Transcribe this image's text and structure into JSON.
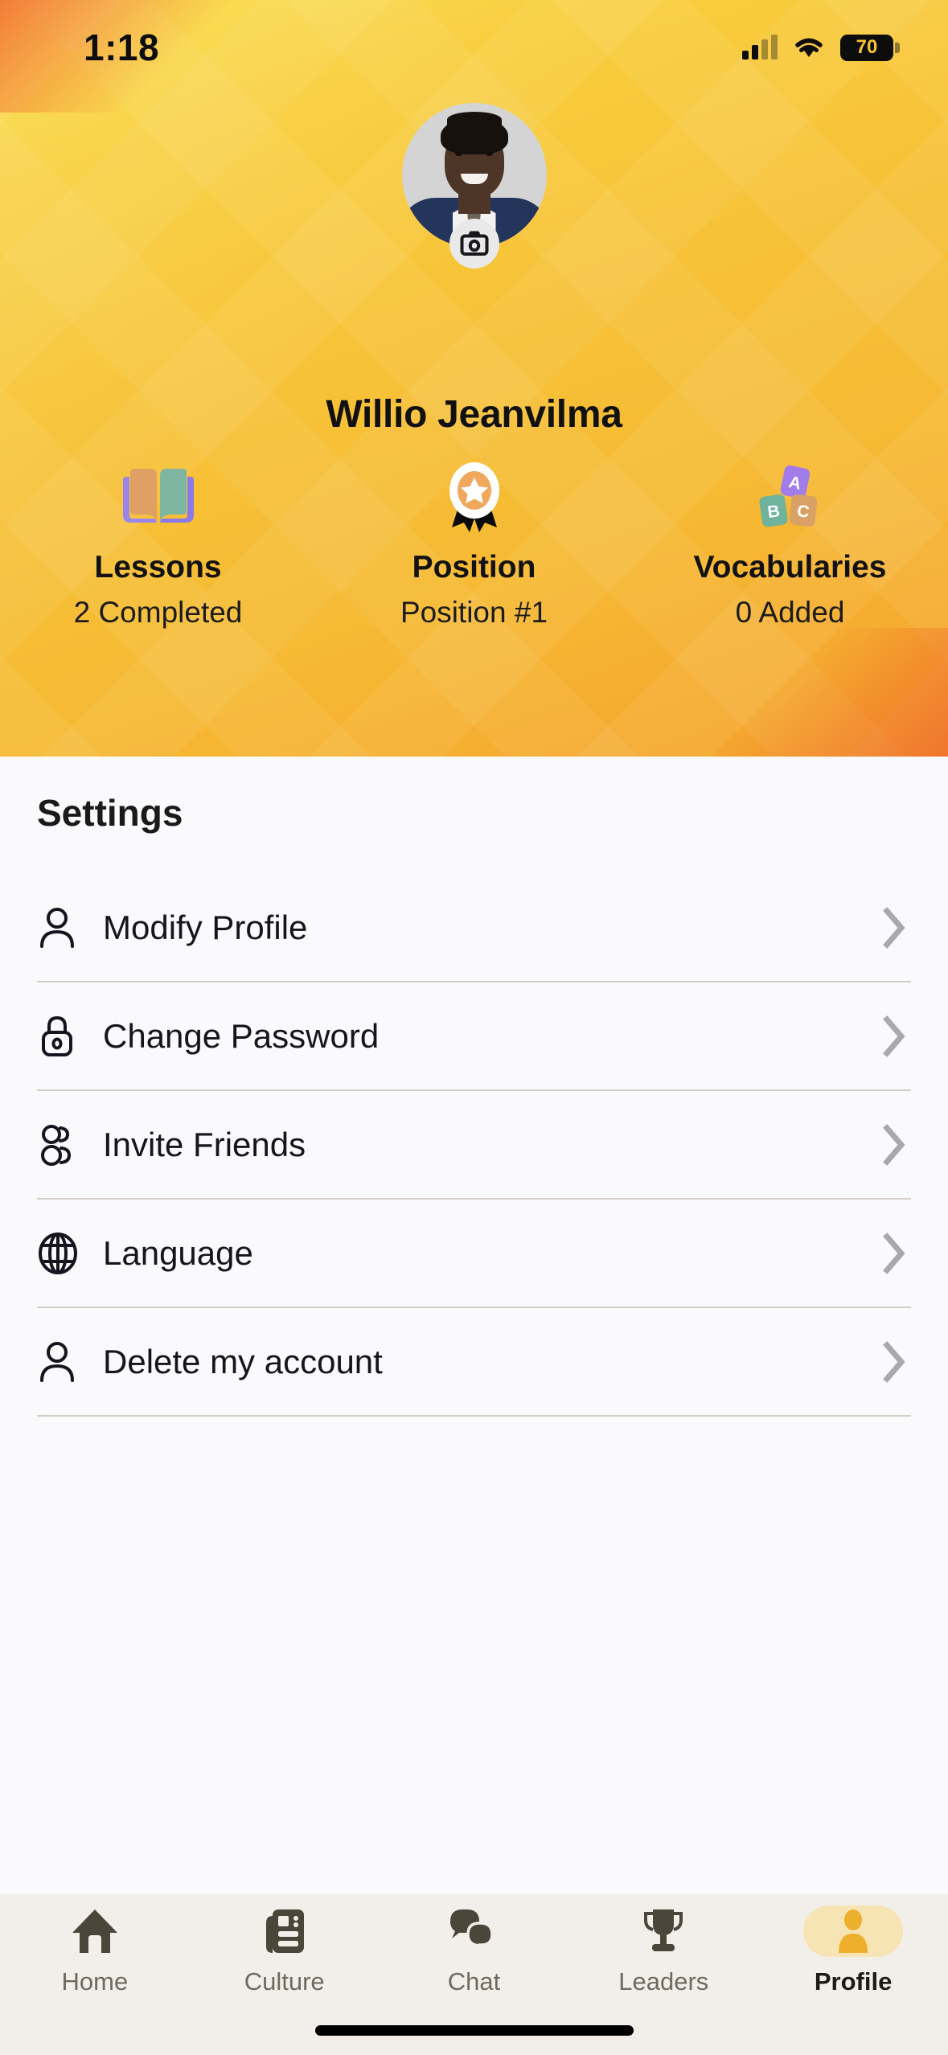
{
  "statusbar": {
    "time": "1:18",
    "battery_level": "70",
    "signal_icon": "cellular-signal-icon",
    "wifi_icon": "wifi-icon",
    "battery_icon": "battery-icon"
  },
  "header": {
    "background_color": "#f7c238",
    "accent_color": "#f05a28",
    "avatar_icon": "user-avatar-photo",
    "camera_badge_icon": "camera-icon",
    "profile_name": "Willio Jeanvilma"
  },
  "stats": [
    {
      "icon": "open-book-icon",
      "label": "Lessons",
      "value": "2 Completed"
    },
    {
      "icon": "medal-award-icon",
      "label": "Position",
      "value": "Position #1"
    },
    {
      "icon": "vocabulary-cards-icon",
      "label": "Vocabularies",
      "value": "0 Added",
      "cards": [
        "A",
        "B",
        "C"
      ]
    }
  ],
  "settings": {
    "title": "Settings",
    "items": [
      {
        "icon": "person-icon",
        "label": "Modify Profile",
        "chevron": "chevron-right-icon"
      },
      {
        "icon": "lock-icon",
        "label": "Change Password",
        "chevron": "chevron-right-icon"
      },
      {
        "icon": "people-group-icon",
        "label": "Invite Friends",
        "chevron": "chevron-right-icon"
      },
      {
        "icon": "globe-icon",
        "label": "Language",
        "chevron": "chevron-right-icon"
      },
      {
        "icon": "person-icon",
        "label": "Delete my account",
        "chevron": "chevron-right-icon"
      }
    ]
  },
  "tabbar": {
    "active": "Profile",
    "active_color": "#eeb02c",
    "inactive_color": "#4a4639",
    "items": [
      {
        "icon": "home-icon",
        "label": "Home"
      },
      {
        "icon": "newspaper-icon",
        "label": "Culture"
      },
      {
        "icon": "chat-bubbles-icon",
        "label": "Chat"
      },
      {
        "icon": "trophy-icon",
        "label": "Leaders"
      },
      {
        "icon": "person-filled-icon",
        "label": "Profile"
      }
    ]
  },
  "colors": {
    "book_cover": "#9b85e8",
    "book_page_left": "#e0a063",
    "book_page_right": "#7db5a0",
    "card_a": "#a27ce8",
    "card_b": "#6fb39c",
    "card_c": "#d9a166",
    "medal_ring": "#ffffff",
    "medal_inner": "#efa85c",
    "divider": "#d5cec3",
    "tab_pill": "#f7e4b4"
  }
}
